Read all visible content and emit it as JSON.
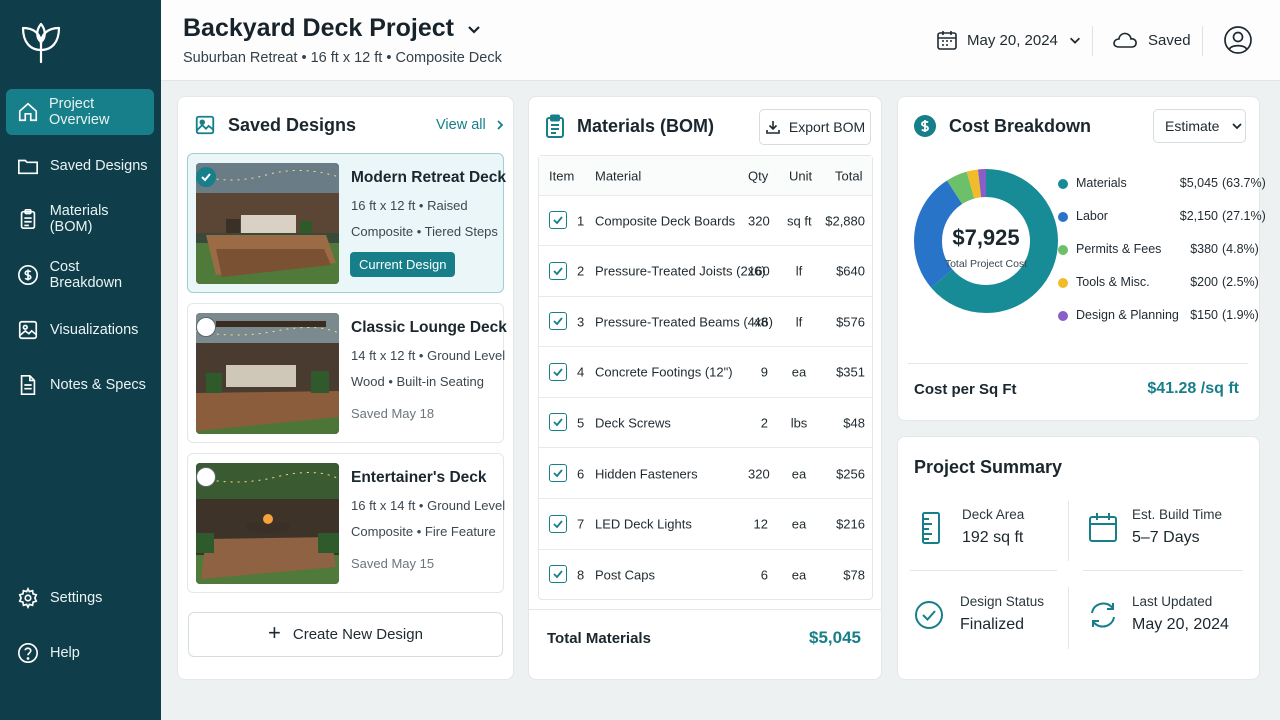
{
  "sidebar": {
    "items": [
      {
        "label": "Project Overview"
      },
      {
        "label": "Saved Designs"
      },
      {
        "label": "Materials (BOM)"
      },
      {
        "label": "Cost Breakdown"
      },
      {
        "label": "Visualizations"
      },
      {
        "label": "Notes & Specs"
      }
    ],
    "bottom": [
      {
        "label": "Settings"
      },
      {
        "label": "Help"
      }
    ]
  },
  "header": {
    "title": "Backyard Deck Project",
    "subtitle": "Suburban Retreat  •  16 ft x 12 ft  •  Composite Deck",
    "date": "May 20, 2024",
    "saved": "Saved"
  },
  "designs": {
    "title": "Saved Designs",
    "view_all": "View all",
    "items": [
      {
        "name": "Modern Retreat Deck",
        "line1": "16 ft x 12 ft  •  Raised",
        "line2": "Composite  •  Tiered Steps",
        "badge": "Current Design",
        "selected": true
      },
      {
        "name": "Classic Lounge Deck",
        "line1": "14 ft x 12 ft  •  Ground Level",
        "line2": "Wood  •  Built-in Seating",
        "saved": "Saved May 18",
        "selected": false
      },
      {
        "name": "Entertainer's Deck",
        "line1": "16 ft x 14 ft  •  Ground Level",
        "line2": "Composite  •  Fire Feature",
        "saved": "Saved May 15",
        "selected": false
      }
    ],
    "create_label": "Create New Design"
  },
  "bom": {
    "title": "Materials (BOM)",
    "export_label": "Export BOM",
    "headers": {
      "item": "Item",
      "material": "Material",
      "qty": "Qty",
      "unit": "Unit",
      "total": "Total"
    },
    "rows": [
      {
        "n": "1",
        "material": "Composite Deck Boards",
        "qty": "320",
        "unit": "sq ft",
        "total": "$2,880"
      },
      {
        "n": "2",
        "material": "Pressure-Treated Joists (2x6)",
        "qty": "160",
        "unit": "lf",
        "total": "$640"
      },
      {
        "n": "3",
        "material": "Pressure-Treated Beams (4x6)",
        "qty": "48",
        "unit": "lf",
        "total": "$576"
      },
      {
        "n": "4",
        "material": "Concrete Footings (12\")",
        "qty": "9",
        "unit": "ea",
        "total": "$351"
      },
      {
        "n": "5",
        "material": "Deck Screws",
        "qty": "2",
        "unit": "lbs",
        "total": "$48"
      },
      {
        "n": "6",
        "material": "Hidden Fasteners",
        "qty": "320",
        "unit": "ea",
        "total": "$256"
      },
      {
        "n": "7",
        "material": "LED Deck Lights",
        "qty": "12",
        "unit": "ea",
        "total": "$216"
      },
      {
        "n": "8",
        "material": "Post Caps",
        "qty": "6",
        "unit": "ea",
        "total": "$78"
      }
    ],
    "total_label": "Total Materials",
    "total_value": "$5,045"
  },
  "cost": {
    "title": "Cost Breakdown",
    "estimate_label": "Estimate",
    "total": "$7,925",
    "total_label": "Total Project Cost",
    "per_sqft_label": "Cost per Sq Ft",
    "per_sqft_value": "$41.28 /sq ft",
    "chart_data": {
      "type": "pie",
      "series": [
        {
          "name": "Materials",
          "amount": "$5,045",
          "pct": "(63.7%)",
          "value": 63.7,
          "color": "#178c96"
        },
        {
          "name": "Labor",
          "amount": "$2,150",
          "pct": "(27.1%)",
          "value": 27.1,
          "color": "#2874c8"
        },
        {
          "name": "Permits & Fees",
          "amount": "$380",
          "pct": "(4.8%)",
          "value": 4.8,
          "color": "#6cc06a"
        },
        {
          "name": "Tools & Misc.",
          "amount": "$200",
          "pct": "(2.5%)",
          "value": 2.5,
          "color": "#f2bb2a"
        },
        {
          "name": "Design & Planning",
          "amount": "$150",
          "pct": "(1.9%)",
          "value": 1.9,
          "color": "#8a5ec8"
        }
      ]
    }
  },
  "summary": {
    "title": "Project Summary",
    "deck_area_label": "Deck Area",
    "deck_area_value": "192 sq ft",
    "build_time_label": "Est. Build Time",
    "build_time_value": "5–7 Days",
    "status_label": "Design Status",
    "status_value": "Finalized",
    "updated_label": "Last Updated",
    "updated_value": "May 20, 2024"
  },
  "colors": {
    "sidebar": "#0f3e4a",
    "accent": "#177f8a"
  }
}
